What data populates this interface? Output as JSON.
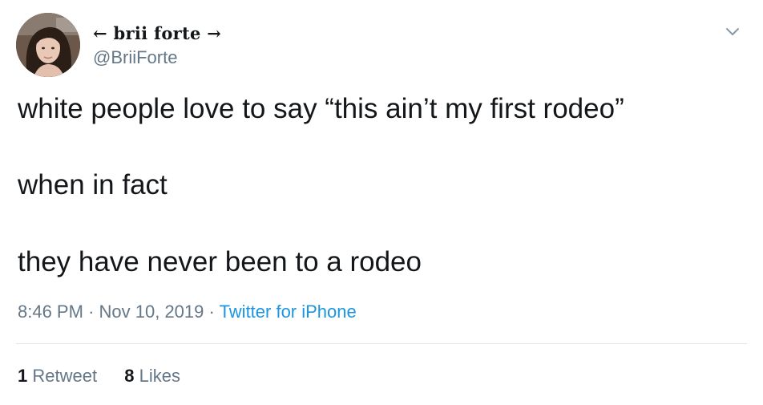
{
  "tweet": {
    "author": {
      "display_name": "← brii forte →",
      "handle": "@BriiForte"
    },
    "text_lines": [
      "white people love to say “this ain’t my first rodeo”",
      "when in fact",
      "they have never been to a rodeo"
    ],
    "time": "8:46 PM",
    "separator": "·",
    "date": "Nov 10, 2019",
    "source": "Twitter for iPhone",
    "stats": {
      "retweets_count": "1",
      "retweets_label": "Retweet",
      "likes_count": "8",
      "likes_label": "Likes"
    }
  },
  "colors": {
    "text": "#14171a",
    "secondary": "#657786",
    "link": "#1b95e0",
    "divider": "#e1e8ed"
  },
  "icons": {
    "menu": "chevron-down-icon",
    "avatar": "profile-photo"
  }
}
